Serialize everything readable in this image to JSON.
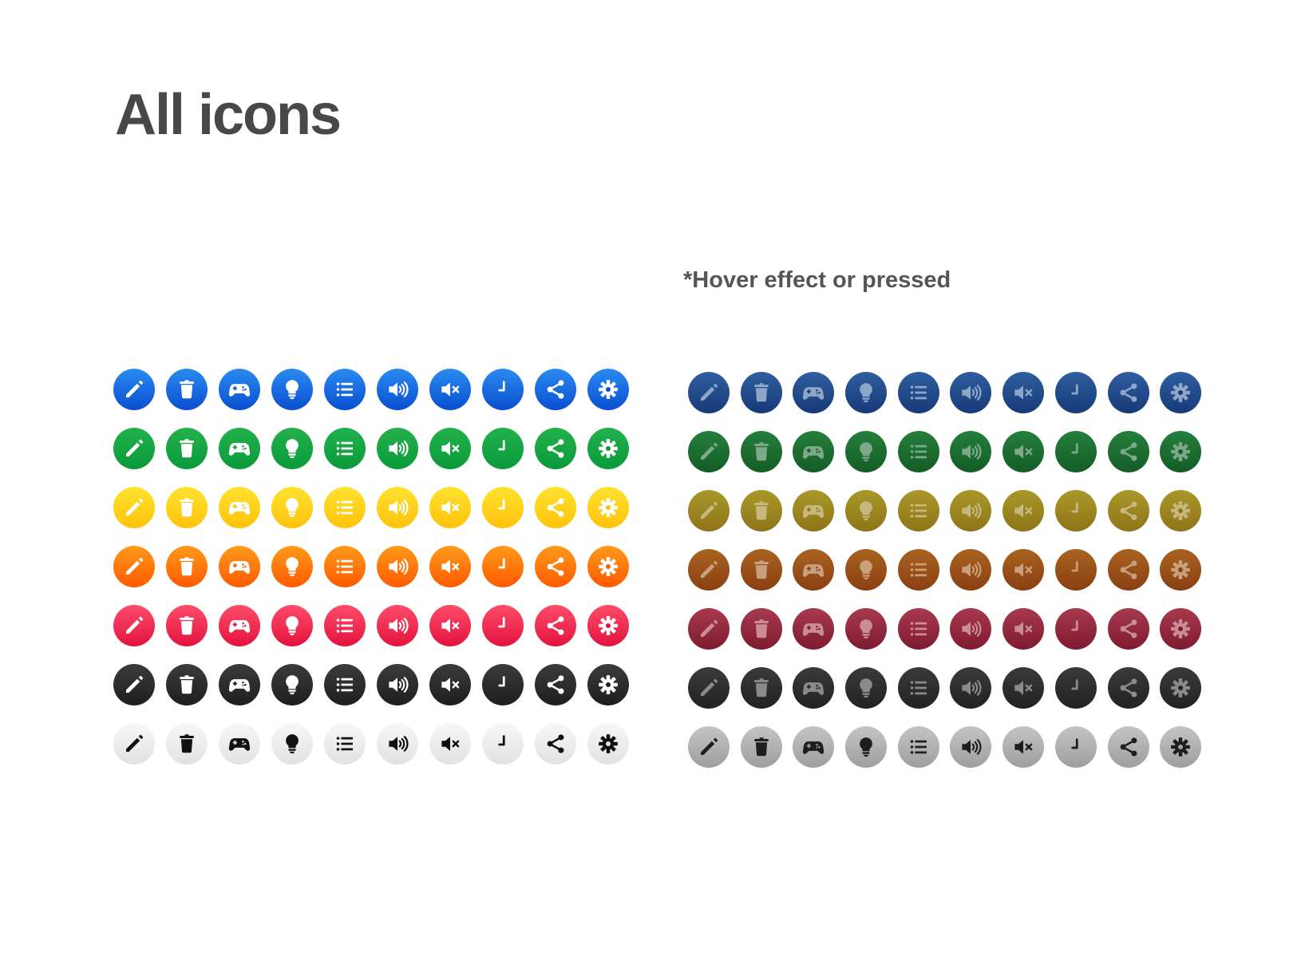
{
  "header": {
    "title": "All icons",
    "hover_note": "*Hover effect or pressed"
  },
  "icons": [
    {
      "name": "pencil",
      "label": "pencil-icon"
    },
    {
      "name": "trash",
      "label": "trash-icon"
    },
    {
      "name": "gamepad",
      "label": "gamepad-icon"
    },
    {
      "name": "bulb",
      "label": "lightbulb-icon"
    },
    {
      "name": "list",
      "label": "list-icon"
    },
    {
      "name": "volume",
      "label": "volume-icon"
    },
    {
      "name": "mute",
      "label": "mute-icon"
    },
    {
      "name": "clock",
      "label": "clock-icon"
    },
    {
      "name": "share",
      "label": "share-icon"
    },
    {
      "name": "gear",
      "label": "gear-icon"
    }
  ],
  "themes": [
    {
      "name": "blue",
      "normal": {
        "top": "#2a8bf0",
        "bottom": "#0a4ed0",
        "glyph": "#ffffff"
      },
      "hover": {
        "top": "#2f5e9e",
        "bottom": "#173a78",
        "glyph": "#8ea6c8"
      }
    },
    {
      "name": "green",
      "normal": {
        "top": "#22b14c",
        "bottom": "#0a9a3a",
        "glyph": "#ffffff"
      },
      "hover": {
        "top": "#257f3b",
        "bottom": "#145c27",
        "glyph": "#7da88a"
      }
    },
    {
      "name": "yellow",
      "normal": {
        "top": "#ffe230",
        "bottom": "#ffc20a",
        "glyph": "#ffffff"
      },
      "hover": {
        "top": "#a9982a",
        "bottom": "#8f7417",
        "glyph": "#c7b880"
      }
    },
    {
      "name": "orange",
      "normal": {
        "top": "#ff9a1a",
        "bottom": "#ff5a00",
        "glyph": "#ffffff"
      },
      "hover": {
        "top": "#a8631f",
        "bottom": "#8a3f12",
        "glyph": "#c8a07e"
      }
    },
    {
      "name": "red",
      "normal": {
        "top": "#ff4c6a",
        "bottom": "#e3133f",
        "glyph": "#ffffff"
      },
      "hover": {
        "top": "#a83a4e",
        "bottom": "#7e1a30",
        "glyph": "#c98d98"
      }
    },
    {
      "name": "dark",
      "normal": {
        "top": "#3c3c3c",
        "bottom": "#1e1e1e",
        "glyph": "#ffffff"
      },
      "hover": {
        "top": "#3a3a3a",
        "bottom": "#222222",
        "glyph": "#8a8a8a"
      }
    },
    {
      "name": "light",
      "normal": {
        "top": "#f7f7f7",
        "bottom": "#e2e2e2",
        "glyph": "#111111"
      },
      "hover": {
        "top": "#c4c4c4",
        "bottom": "#9e9e9e",
        "glyph": "#1e1e1e"
      }
    }
  ]
}
